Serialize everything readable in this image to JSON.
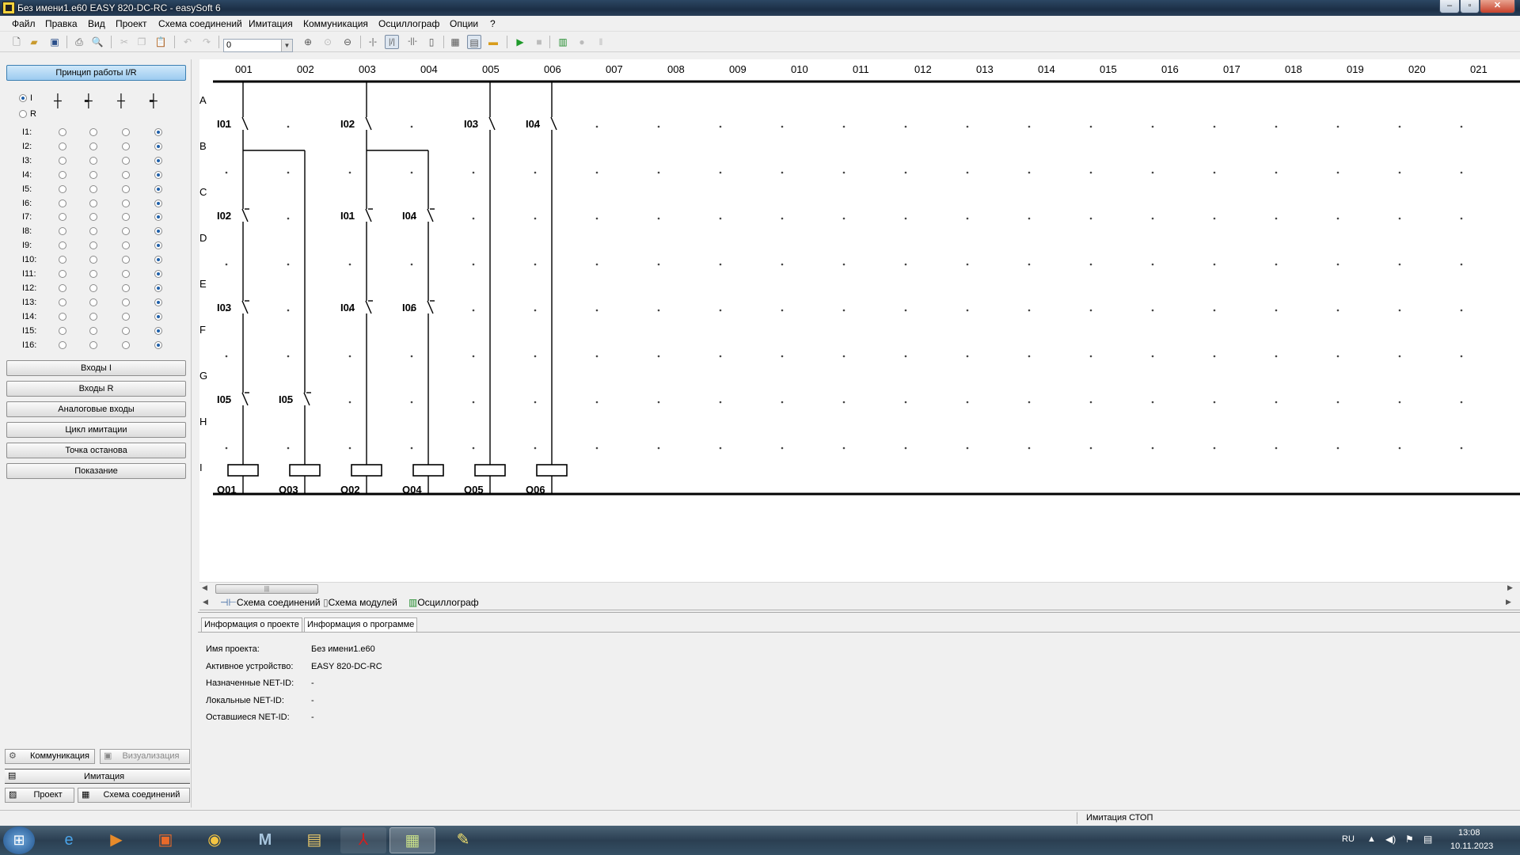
{
  "window": {
    "title": "Без имени1.e60 EASY 820-DC-RC - easySoft 6",
    "min_label": "–",
    "max_label": "▫",
    "close_label": "✕"
  },
  "menu": [
    "Файл",
    "Правка",
    "Вид",
    "Проект",
    "Схема соединений",
    "Имитация",
    "Коммуникация",
    "Осциллограф",
    "Опции",
    "?"
  ],
  "toolbar": {
    "zoom_value": "0"
  },
  "left_panel": {
    "principle_button": "Принцип работы I/R",
    "radio_i_label": "I",
    "radio_r_label": "R",
    "contact_symbols": [
      "┼",
      "┽",
      "┼",
      "┽"
    ],
    "inputs": [
      "I1:",
      "I2:",
      "I3:",
      "I4:",
      "I5:",
      "I6:",
      "I7:",
      "I8:",
      "I9:",
      "I10:",
      "I11:",
      "I12:",
      "I13:",
      "I14:",
      "I15:",
      "I16:"
    ],
    "selected_column": 4,
    "buttons": [
      "Входы I",
      "Входы R",
      "Аналоговые входы",
      "Цикл имитации",
      "Точка останова",
      "Показание"
    ],
    "bottom": {
      "communication": "Коммуникация",
      "visualization": "Визуализация",
      "imitation": "Имитация",
      "project": "Проект",
      "circuit": "Схема соединений"
    }
  },
  "diagram": {
    "columns": [
      "001",
      "002",
      "003",
      "004",
      "005",
      "006",
      "007",
      "008",
      "009",
      "010",
      "011",
      "012",
      "013",
      "014",
      "015",
      "016",
      "017",
      "018",
      "019",
      "020",
      "021"
    ],
    "rows": [
      "A",
      "B",
      "C",
      "D",
      "E",
      "F",
      "G",
      "H",
      "I"
    ],
    "contacts": [
      {
        "label": "I01",
        "col": 1,
        "row": 1
      },
      {
        "label": "I02",
        "col": 1,
        "row": 3
      },
      {
        "label": "I03",
        "col": 1,
        "row": 5
      },
      {
        "label": "I05",
        "col": 1,
        "row": 7
      },
      {
        "label": "I05",
        "col": 2,
        "row": 7
      },
      {
        "label": "I02",
        "col": 3,
        "row": 1
      },
      {
        "label": "I01",
        "col": 3,
        "row": 3
      },
      {
        "label": "I04",
        "col": 3,
        "row": 5
      },
      {
        "label": "I04",
        "col": 4,
        "row": 3
      },
      {
        "label": "I06",
        "col": 4,
        "row": 5
      },
      {
        "label": "I03",
        "col": 5,
        "row": 1
      },
      {
        "label": "I04",
        "col": 6,
        "row": 1
      }
    ],
    "coils": [
      "Q01",
      "Q03",
      "Q02",
      "Q04",
      "Q05",
      "Q06"
    ]
  },
  "doc_tabs": [
    "Схема соединений",
    "Схема модулей",
    "Осциллограф"
  ],
  "info": {
    "tabs": [
      "Информация о проекте",
      "Информация о программе"
    ],
    "rows": [
      {
        "label": "Имя проекта:",
        "value": "Без имени1.e60"
      },
      {
        "label": "Активное устройство:",
        "value": "EASY 820-DC-RC"
      },
      {
        "label": "Назначенные NET-ID:",
        "value": "-"
      },
      {
        "label": "Локальные NET-ID:",
        "value": "-"
      },
      {
        "label": "Оставшиеся NET-ID:",
        "value": "-"
      }
    ]
  },
  "status": {
    "text": "Имитация СТОП"
  },
  "taskbar": {
    "language": "RU",
    "time": "13:08",
    "date": "10.11.2023"
  },
  "colors": {
    "accent": "#9ccbf0",
    "titlebar": "#1c2f46",
    "taskbar": "#2b3f52"
  }
}
